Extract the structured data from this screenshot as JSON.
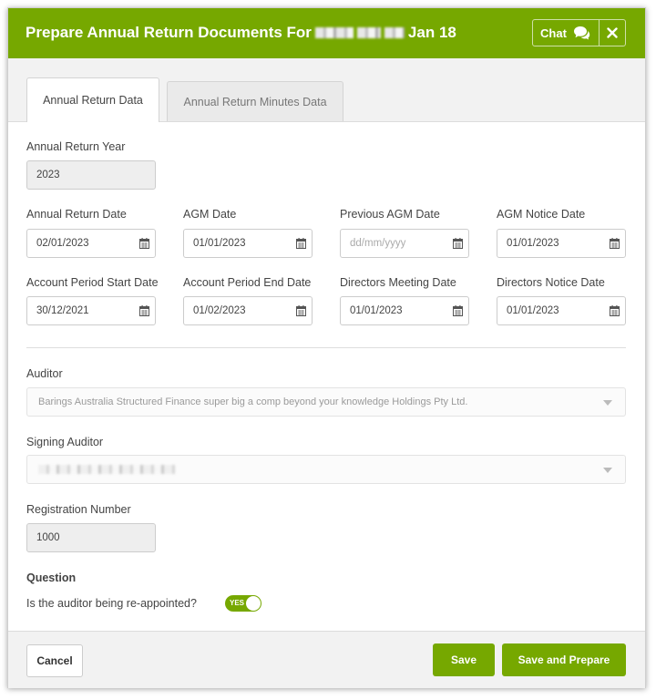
{
  "header": {
    "title_prefix": "Prepare Annual Return Documents For",
    "title_suffix": "Jan 18",
    "chat_label": "Chat",
    "icons": [
      "chat-bubbles-icon",
      "close-icon"
    ],
    "accent_color": "#76a800"
  },
  "tabs": [
    {
      "label": "Annual Return Data",
      "active": true
    },
    {
      "label": "Annual Return Minutes Data",
      "active": false
    }
  ],
  "form": {
    "annual_return_year": {
      "label": "Annual Return Year",
      "value": "2023"
    },
    "annual_return_date": {
      "label": "Annual Return Date",
      "value": "02/01/2023"
    },
    "agm_date": {
      "label": "AGM Date",
      "value": "01/01/2023"
    },
    "previous_agm_date": {
      "label": "Previous AGM Date",
      "value": "",
      "placeholder": "dd/mm/yyyy"
    },
    "agm_notice_date": {
      "label": "AGM Notice Date",
      "value": "01/01/2023"
    },
    "account_period_start": {
      "label": "Account Period Start Date",
      "value": "30/12/2021"
    },
    "account_period_end": {
      "label": "Account Period End Date",
      "value": "01/02/2023"
    },
    "directors_meeting_date": {
      "label": "Directors Meeting Date",
      "value": "01/01/2023"
    },
    "directors_notice_date": {
      "label": "Directors Notice Date",
      "value": "01/01/2023"
    },
    "auditor": {
      "label": "Auditor",
      "value": "Barings Australia Structured Finance super big a comp beyond your knowledge Holdings Pty Ltd."
    },
    "signing_auditor": {
      "label": "Signing Auditor"
    },
    "registration_number": {
      "label": "Registration Number",
      "value": "1000"
    }
  },
  "question": {
    "heading": "Question",
    "text": "Is the auditor being re-appointed?",
    "toggle_label": "YES",
    "toggle_on": true
  },
  "footer": {
    "cancel_label": "Cancel",
    "save_label": "Save",
    "save_prepare_label": "Save and Prepare"
  }
}
